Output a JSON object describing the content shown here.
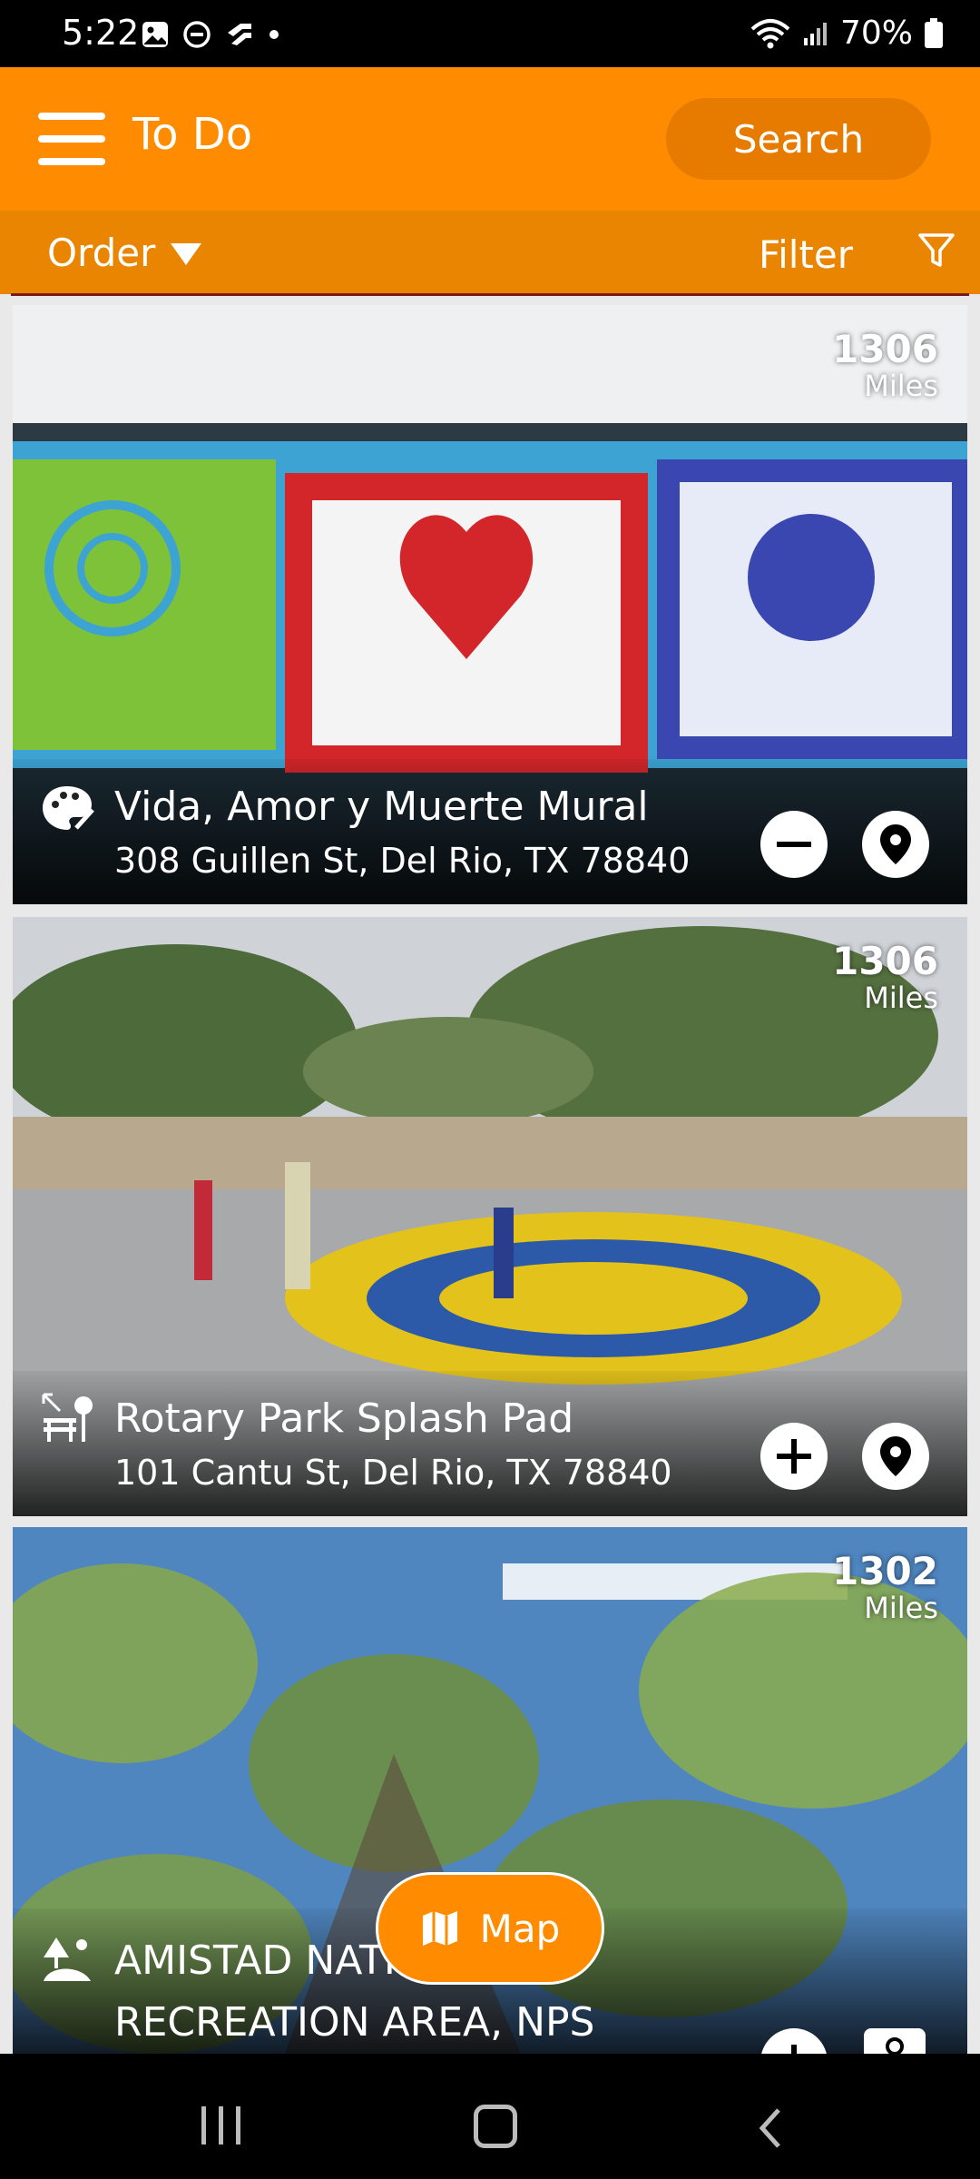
{
  "status_bar": {
    "time": "5:22",
    "battery": "70%"
  },
  "app_bar": {
    "title": "To Do",
    "search_label": "Search"
  },
  "sort_bar": {
    "order_label": "Order",
    "filter_label": "Filter"
  },
  "cards": [
    {
      "title": "Vida, Amor y Muerte Mural",
      "address": "308 Guillen St, Del Rio, TX 78840",
      "distance": "1306",
      "distance_unit": "Miles",
      "category_icon": "art-palette-icon",
      "action_icon": "minus-circle-icon"
    },
    {
      "title": "Rotary Park Splash Pad",
      "address": "101 Cantu St, Del Rio, TX 78840",
      "distance": "1306",
      "distance_unit": "Miles",
      "category_icon": "park-bench-icon",
      "action_icon": "plus-circle-icon"
    },
    {
      "title_line1": "AMISTAD NATI",
      "title_line2": "RECREATION AREA, NPS",
      "distance": "1302",
      "distance_unit": "Miles",
      "category_icon": "nature-icon",
      "action_icon": "plus-circle-icon"
    }
  ],
  "map_button": {
    "label": "Map"
  },
  "colors": {
    "brand": "#ff8c00",
    "brand_dark": "#e98500"
  }
}
